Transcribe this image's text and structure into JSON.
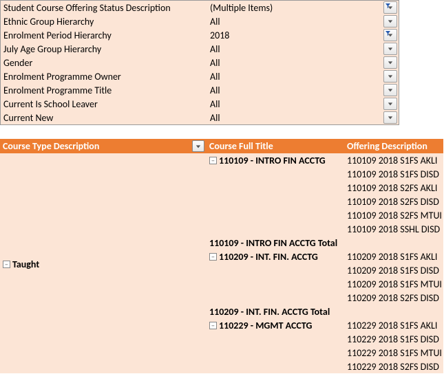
{
  "filters": [
    {
      "label": "Student Course Offering Status Description",
      "value": "(Multiple Items)",
      "filtered": true
    },
    {
      "label": "Ethnic Group Hierarchy",
      "value": "All",
      "filtered": false
    },
    {
      "label": "Enrolment Period Hierarchy",
      "value": "2018",
      "filtered": true
    },
    {
      "label": "July Age Group Hierarchy",
      "value": "All",
      "filtered": false
    },
    {
      "label": "Gender",
      "value": "All",
      "filtered": false
    },
    {
      "label": "Enrolment Programme Owner",
      "value": "All",
      "filtered": false
    },
    {
      "label": "Enrolment Programme Title",
      "value": "All",
      "filtered": false
    },
    {
      "label": "Current Is School Leaver",
      "value": "All",
      "filtered": false
    },
    {
      "label": "Current New",
      "value": "All",
      "filtered": false
    }
  ],
  "headers": {
    "col_a": "Course Type Description",
    "col_b": "Course Full Title",
    "col_c": "Offering Description"
  },
  "row_label": "Taught",
  "courses": [
    {
      "title": "110109 - INTRO FIN ACCTG",
      "total": "110109 - INTRO FIN ACCTG Total",
      "offerings": [
        "110109 2018 S1FS AKLI",
        "110109 2018 S1FS DISD",
        "110109 2018 S2FS AKLI",
        "110109 2018 S2FS DISD",
        "110109 2018 S2FS MTUI",
        "110109 2018 SSHL DISD"
      ]
    },
    {
      "title": "110209 - INT. FIN. ACCTG",
      "total": "110209 - INT. FIN. ACCTG Total",
      "offerings": [
        "110209 2018 S1FS AKLI",
        "110209 2018 S1FS DISD",
        "110209 2018 S1FS MTUI",
        "110209 2018 S2FS DISD"
      ]
    },
    {
      "title": "110229 - MGMT ACCTG",
      "total": null,
      "offerings": [
        "110229 2018 S1FS AKLI",
        "110229 2018 S1FS DISD",
        "110229 2018 S1FS MTUI",
        "110229 2018 S2FS DISD"
      ]
    }
  ]
}
